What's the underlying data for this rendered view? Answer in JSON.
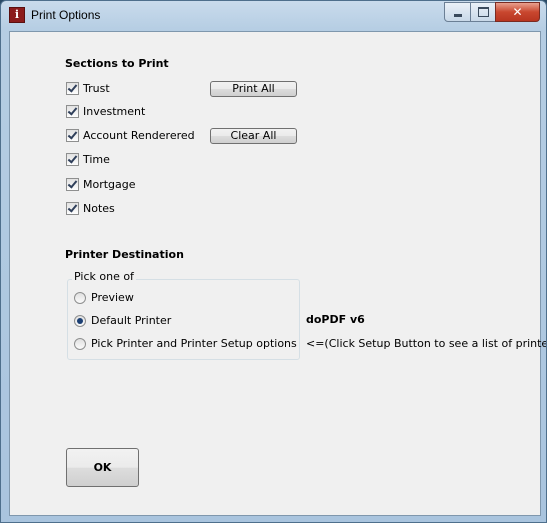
{
  "window": {
    "title": "Print Options",
    "app_icon_letter": "i"
  },
  "sections": {
    "heading": "Sections to Print",
    "items": [
      {
        "label": "Trust",
        "checked": true
      },
      {
        "label": "Investment",
        "checked": true
      },
      {
        "label": "Account Renderered",
        "checked": true
      },
      {
        "label": "Time",
        "checked": true
      },
      {
        "label": "Mortgage",
        "checked": true
      },
      {
        "label": "Notes",
        "checked": true
      }
    ],
    "print_all_label": "Print All",
    "clear_all_label": "Clear All"
  },
  "printer": {
    "heading": "Printer Destination",
    "group_label": "Pick one of",
    "options": [
      {
        "label": "Preview",
        "selected": false
      },
      {
        "label": "Default Printer",
        "selected": true
      },
      {
        "label": "Pick Printer and Printer Setup options",
        "selected": false
      }
    ],
    "default_printer_name": "doPDF v6",
    "setup_hint": "<=(Click Setup Button to  see a list of printers)"
  },
  "ok_label": "OK"
}
